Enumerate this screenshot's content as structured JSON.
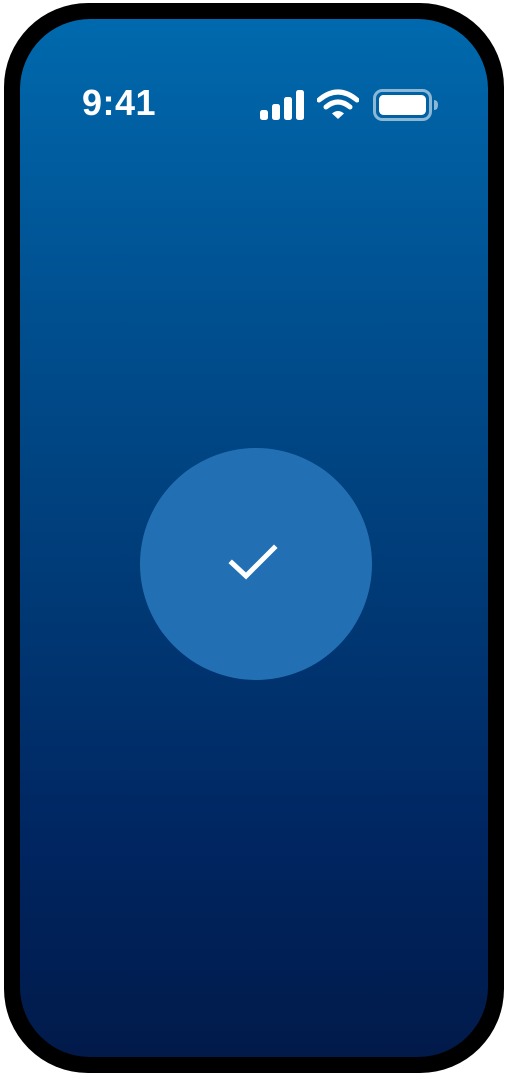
{
  "status_bar": {
    "time": "9:41",
    "icons": [
      "signal-icon",
      "wifi-icon",
      "battery-icon"
    ]
  },
  "main": {
    "status_icon": "check-icon"
  },
  "colors": {
    "gradient_top": "#0069ad",
    "gradient_bottom": "#011a4a",
    "circle": "#2270b3",
    "foreground": "#ffffff",
    "frame": "#000000"
  }
}
